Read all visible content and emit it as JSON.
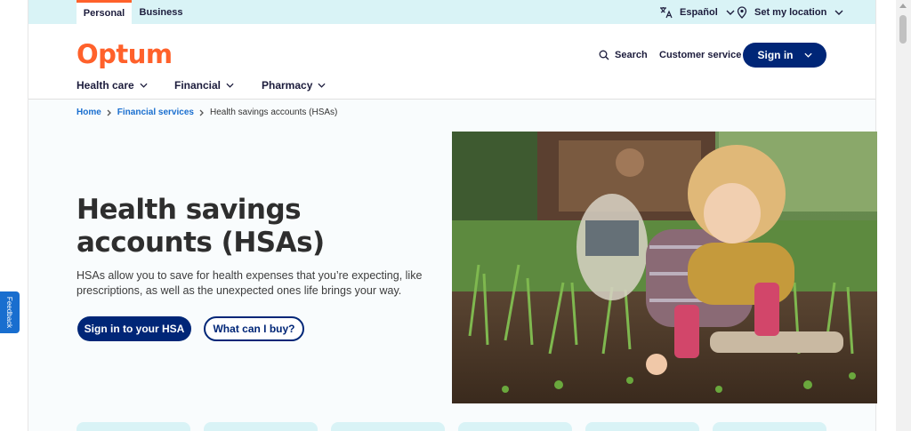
{
  "utility_bar": {
    "segments": [
      "Personal",
      "Business"
    ],
    "language_label": "Español",
    "location_label": "Set my location"
  },
  "header": {
    "logo": "Optum",
    "search_label": "Search",
    "customer_service_label": "Customer service",
    "signin_label": "Sign in",
    "nav": [
      "Health care",
      "Financial",
      "Pharmacy"
    ]
  },
  "breadcrumb": {
    "items": [
      "Home",
      "Financial services"
    ],
    "current": "Health savings accounts (HSAs)"
  },
  "hero": {
    "title": "Health savings accounts (HSAs)",
    "description": "HSAs allow you to save for health expenses that you’re expecting, like prescriptions, as well as the unexpected ones life brings your way.",
    "primary_button": "Sign in to your HSA",
    "secondary_button": "What can I buy?"
  },
  "feedback_label": "Feedback",
  "colors": {
    "brand_orange": "#ff612b",
    "navy": "#002677",
    "link_blue": "#196ecf",
    "utility_bg": "#d9f3f6"
  }
}
